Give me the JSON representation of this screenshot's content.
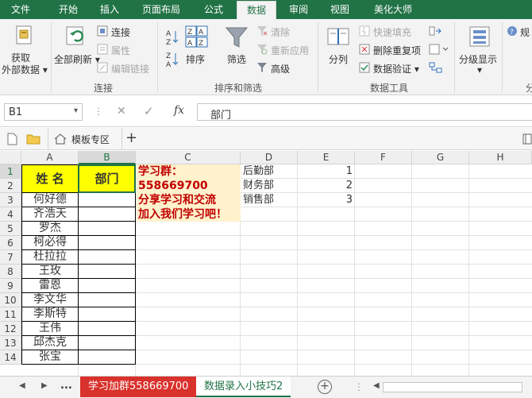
{
  "ribbon_tabs": [
    "文件",
    "开始",
    "插入",
    "页面布局",
    "公式",
    "数据",
    "审阅",
    "视图",
    "美化大师"
  ],
  "active_tab": "数据",
  "colors": {
    "excel_green": "#217346",
    "highlight_yellow": "#ffff00",
    "note_bg": "#fff2cc",
    "note_text": "#c00000",
    "red_tab": "#d9312b"
  },
  "ribbon": {
    "get_external": [
      "获取",
      "外部数据"
    ],
    "refresh_all": "全部刷新",
    "connections": "连接",
    "properties": "属性",
    "edit_links": "编辑链接",
    "group_connections": "连接",
    "sort_asc_icon": "sort-az-icon",
    "sort": "排序",
    "filter": "筛选",
    "clear": "清除",
    "reapply": "重新应用",
    "advanced": "高级",
    "group_sort_filter": "排序和筛选",
    "text_to_columns": "分列",
    "flash_fill": "快速填充",
    "remove_duplicates": "删除重复项",
    "data_validation": "数据验证",
    "group_data_tools": "数据工具",
    "outline": "分级显示",
    "rules_cut": "规",
    "group_cut": "分"
  },
  "formula_bar": {
    "name_box": "B1",
    "formula": "部门"
  },
  "file_strip": {
    "template_zone": "模板专区"
  },
  "columns": [
    "A",
    "B",
    "C",
    "D",
    "E",
    "F",
    "G",
    "H"
  ],
  "rows": [
    "1",
    "2",
    "3",
    "4",
    "5",
    "6",
    "7",
    "8",
    "9",
    "10",
    "11",
    "12",
    "13",
    "14"
  ],
  "table": {
    "header_name": "姓 名",
    "header_dept": "部门",
    "names": [
      "何好德",
      "齐浩天",
      "罗杰",
      "柯必得",
      "杜拉拉",
      "王玫",
      "雷恩",
      "李文华",
      "李斯特",
      "王伟",
      "邱杰克",
      "张宝"
    ]
  },
  "note": [
    "学习群：",
    "558669700",
    "分享学习和交流",
    "加入我们学习吧！"
  ],
  "dept_list": [
    {
      "name": "后勤部",
      "num": "1"
    },
    {
      "name": "财务部",
      "num": "2"
    },
    {
      "name": "销售部",
      "num": "3"
    }
  ],
  "sheet_tabs": {
    "dots": "...",
    "tab1": "学习加群558669700",
    "tab2": "数据录入小技巧2"
  }
}
